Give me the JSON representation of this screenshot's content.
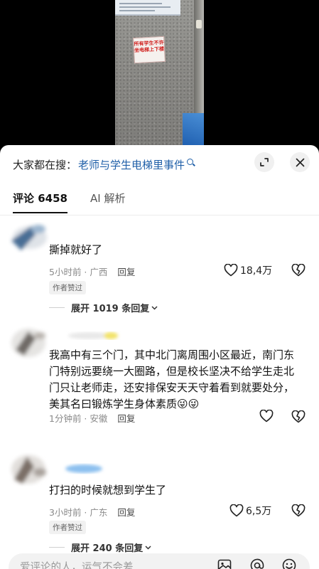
{
  "video": {
    "sign_text": "所有学生不许坐电梯上下楼"
  },
  "search": {
    "prefix": "大家都在搜：",
    "term": "老师与学生电梯里事件"
  },
  "tabs": [
    {
      "label": "评论 6458",
      "active": true
    },
    {
      "label": "AI 解析",
      "active": false
    }
  ],
  "comments": [
    {
      "text": "撕掉就好了",
      "time_location": "5小时前 · 广西",
      "reply_label": "回复",
      "likes": "18,4万",
      "author_liked": "作者赞过",
      "expand_replies": "展开 1019 条回复"
    },
    {
      "text": "我高中有三个门，其中北门离周围小区最近，南门东门特别远要绕一大圈路，但是校长坚决不给学生走北门只让老师走，还安排保安天天守着看到就要处分，美其名曰锻炼学生身体素质😜😜",
      "time_location": "1分钟前 · 安徽",
      "reply_label": "回复",
      "likes": ""
    },
    {
      "text": "打扫的时候就想到学生了",
      "time_location": "3小时前 · 广东",
      "reply_label": "回复",
      "likes": "6,5万",
      "author_liked": "作者赞过",
      "expand_replies": "展开 240 条回复"
    }
  ],
  "input": {
    "placeholder": "爱评论的人，运气不会差"
  },
  "icons": {
    "expand": "expand-icon",
    "close": "close-icon",
    "heart": "heart-icon",
    "dislike": "broken-heart-icon",
    "image": "image-icon",
    "mention": "at-icon",
    "emoji": "emoji-icon"
  },
  "colors": {
    "search_term": "#1f5fa8",
    "text": "#111111",
    "meta": "#8a8a8a"
  }
}
